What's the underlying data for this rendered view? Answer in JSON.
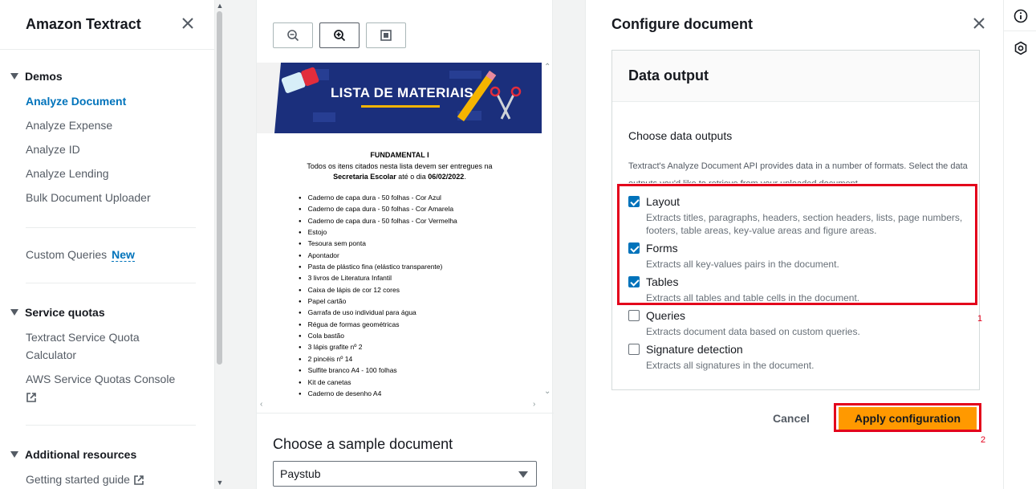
{
  "sidebar": {
    "title": "Amazon Textract",
    "demos_label": "Demos",
    "demo_items": [
      "Analyze Document",
      "Analyze Expense",
      "Analyze ID",
      "Analyze Lending",
      "Bulk Document Uploader"
    ],
    "custom_queries": "Custom Queries",
    "new_badge": "New",
    "service_quotas_label": "Service quotas",
    "quota_items": [
      "Textract Service Quota Calculator",
      "AWS Service Quotas Console"
    ],
    "additional_label": "Additional resources",
    "getting_started": "Getting started guide"
  },
  "viewer": {
    "banner_title": "LISTA DE MATERIAIS",
    "heading": "FUNDAMENTAL I",
    "intro_line1": "Todos os itens citados nesta lista devem ser entregues na",
    "intro_bold1": "Secretaria Escolar",
    "intro_mid": " até o dia ",
    "intro_bold2": "06/02/2022",
    "intro_end": ".",
    "items": [
      "Caderno de capa dura - 50 folhas - Cor Azul",
      "Caderno de capa dura - 50 folhas - Cor Amarela",
      "Caderno de capa dura - 50 folhas - Cor Vermelha",
      "Estojo",
      "Tesoura sem ponta",
      "Apontador",
      "Pasta de plástico fina (elástico transparente)",
      "3 livros de Literatura Infantil",
      "Caixa de lápis de cor 12 cores",
      "Papel cartão",
      "Garrafa de uso individual para água",
      "Régua de formas geométricas",
      "Cola bastão",
      "3 lápis grafite nº 2",
      "2 pincéis nº 14",
      "Sulfite branco A4 - 100 folhas",
      "Kit de canetas",
      "Caderno de desenho A4"
    ],
    "sample_label": "Choose a sample document",
    "sample_value": "Paystub"
  },
  "config": {
    "title": "Configure document",
    "card_title": "Data output",
    "choose_label": "Choose data outputs",
    "description": "Textract's Analyze Document API provides data in a number of formats. Select the data outputs you'd like to retrieve from your uploaded document.",
    "options": [
      {
        "label": "Layout",
        "desc": "Extracts titles, paragraphs, headers, section headers, lists, page numbers, footers, table areas, key-value areas and figure areas.",
        "checked": true
      },
      {
        "label": "Forms",
        "desc": "Extracts all key-values pairs in the document.",
        "checked": true
      },
      {
        "label": "Tables",
        "desc": "Extracts all tables and table cells in the document.",
        "checked": true
      },
      {
        "label": "Queries",
        "desc": "Extracts document data based on custom queries.",
        "checked": false
      },
      {
        "label": "Signature detection",
        "desc": "Extracts all signatures in the document.",
        "checked": false
      }
    ],
    "annotation_1": "1",
    "annotation_2": "2",
    "cancel_label": "Cancel",
    "apply_label": "Apply configuration"
  },
  "colors": {
    "accent": "#0073bb",
    "primary_button": "#ff9900",
    "annotation_red": "#e3001b"
  },
  "icons": [
    "close-icon",
    "external-link-icon",
    "zoom-out-icon",
    "zoom-in-icon",
    "fit-page-icon",
    "drag-handle-icon",
    "info-icon",
    "settings-hex-icon"
  ]
}
